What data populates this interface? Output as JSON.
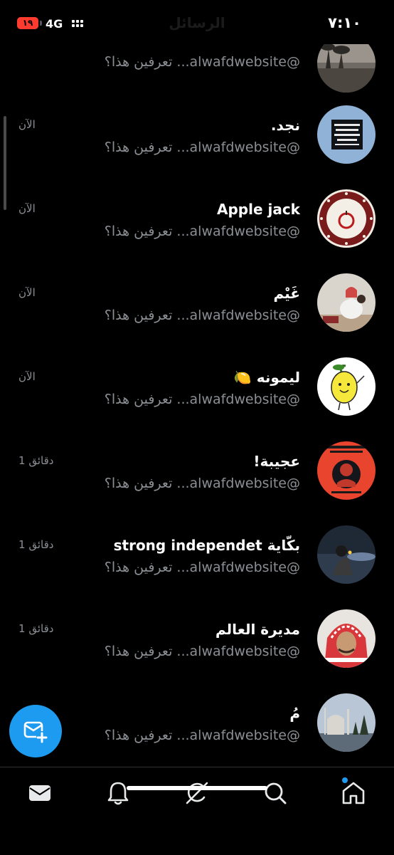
{
  "status_bar": {
    "time": "٧:١٠",
    "battery": "١٩",
    "network": "4G"
  },
  "header": {
    "title": "الرسائل"
  },
  "conversations": [
    {
      "name": "",
      "message": "@alwafdwebsite... تعرفين هذا؟",
      "time": ""
    },
    {
      "name": "نجد.",
      "message": "@alwafdwebsite... تعرفين هذا؟",
      "time": "الآن"
    },
    {
      "name": "Apple jack",
      "message": "@alwafdwebsite... تعرفين هذا؟",
      "time": "الآن"
    },
    {
      "name": "غَيْم",
      "message": "@alwafdwebsite... تعرفين هذا؟",
      "time": "الآن"
    },
    {
      "name": "ليمونه 🍋",
      "message": "@alwafdwebsite... تعرفين هذا؟",
      "time": "الآن"
    },
    {
      "name": "عجيبة!",
      "message": "@alwafdwebsite... تعرفين هذا؟",
      "time": "1 دقائق"
    },
    {
      "name": "بكّاية strong independet",
      "message": "@alwafdwebsite... تعرفين هذا؟",
      "time": "1 دقائق"
    },
    {
      "name": "مديرة العالم",
      "message": "@alwafdwebsite... تعرفين هذا؟",
      "time": "1 دقائق"
    },
    {
      "name": "مُ",
      "message": "@alwafdwebsite... تعرفين هذا؟",
      "time": ""
    }
  ],
  "fab": {
    "icon": "new-message-icon"
  },
  "tab_bar": {
    "tabs": [
      {
        "icon": "messages-icon",
        "active": false
      },
      {
        "icon": "bell-icon",
        "active": false
      },
      {
        "icon": "grok-icon",
        "active": false
      },
      {
        "icon": "search-icon",
        "active": false
      },
      {
        "icon": "home-icon",
        "active": true
      }
    ]
  },
  "colors": {
    "accent": "#1d9bf0",
    "background": "#000000",
    "secondary_text": "#8b8f94"
  }
}
